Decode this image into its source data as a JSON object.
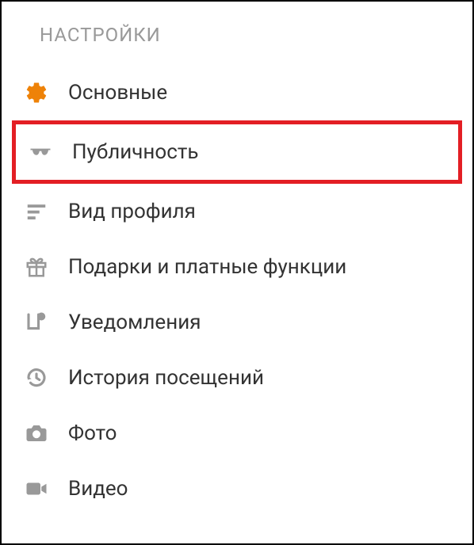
{
  "header": {
    "title": "НАСТРОЙКИ"
  },
  "menu": {
    "items": [
      {
        "label": "Основные",
        "icon": "gear-icon",
        "highlighted": false
      },
      {
        "label": "Публичность",
        "icon": "sunglasses-icon",
        "highlighted": true
      },
      {
        "label": "Вид профиля",
        "icon": "profile-view-icon",
        "highlighted": false
      },
      {
        "label": "Подарки и платные функции",
        "icon": "gift-icon",
        "highlighted": false
      },
      {
        "label": "Уведомления",
        "icon": "notifications-icon",
        "highlighted": false
      },
      {
        "label": "История посещений",
        "icon": "history-icon",
        "highlighted": false
      },
      {
        "label": "Фото",
        "icon": "camera-icon",
        "highlighted": false
      },
      {
        "label": "Видео",
        "icon": "video-icon",
        "highlighted": false
      }
    ]
  },
  "colors": {
    "accent": "#ee8208",
    "highlight_border": "#e31e24",
    "icon_gray": "#999999",
    "text": "#333333"
  }
}
